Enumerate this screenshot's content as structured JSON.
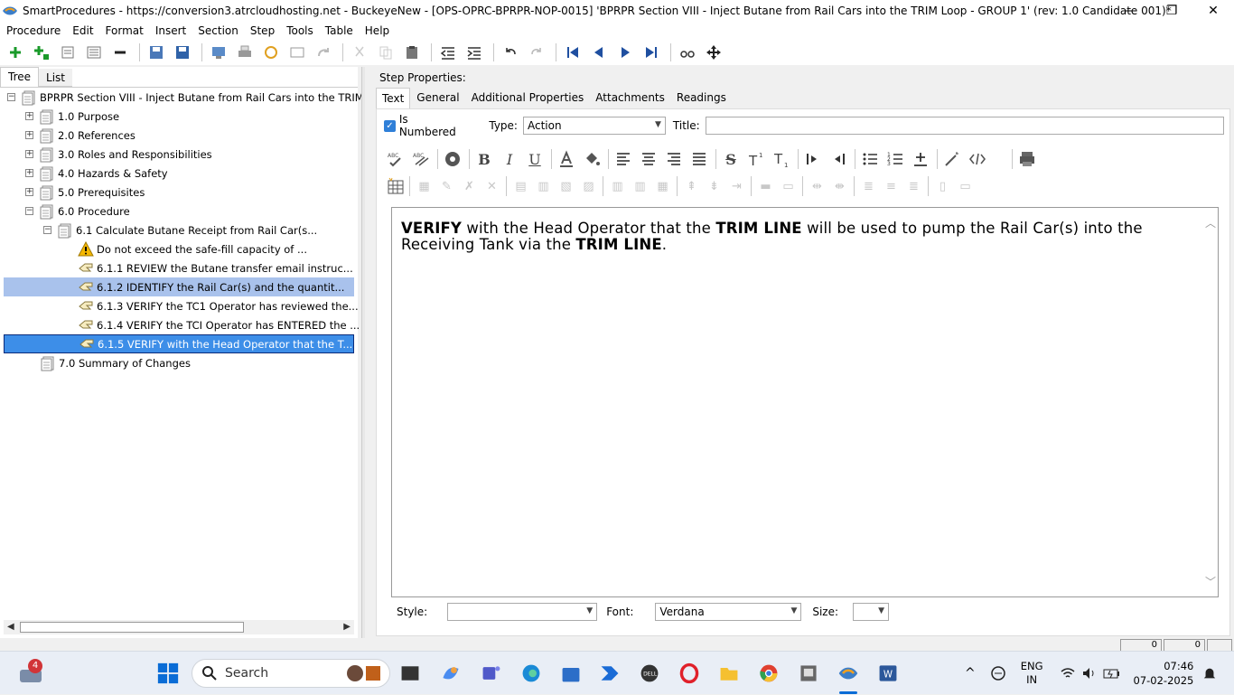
{
  "window": {
    "title": "SmartProcedures - https://conversion3.atrcloudhosting.net - BuckeyeNew - [OPS-OPRC-BPRPR-NOP-0015] 'BPRPR Section VIII - Inject Butane from Rail Cars into the TRIM Loop - GROUP 1' (rev: 1.0 Candidate 001)*",
    "minimize": "—",
    "maximize": "❐",
    "close": "✕"
  },
  "menu": [
    "Procedure",
    "Edit",
    "Format",
    "Insert",
    "Section",
    "Step",
    "Tools",
    "Table",
    "Help"
  ],
  "left": {
    "tabs": [
      "Tree",
      "List"
    ],
    "tree": [
      {
        "label": "BPRPR Section VIII - Inject Butane from Rail Cars into the TRIM L...",
        "expander": "−",
        "icon": "document-icon"
      },
      {
        "label": "1.0 Purpose",
        "expander": "+",
        "icon": "section-icon"
      },
      {
        "label": "2.0 References",
        "expander": "+",
        "icon": "section-icon"
      },
      {
        "label": "3.0 Roles and Responsibilities",
        "expander": "+",
        "icon": "section-icon"
      },
      {
        "label": "4.0 Hazards & Safety",
        "expander": "+",
        "icon": "section-icon"
      },
      {
        "label": "5.0 Prerequisites",
        "expander": "+",
        "icon": "section-icon"
      },
      {
        "label": "6.0 Procedure",
        "expander": "−",
        "icon": "section-icon"
      },
      {
        "label": "6.1 Calculate Butane Receipt from Rail Car(s...",
        "expander": "−",
        "icon": "section-icon"
      },
      {
        "label": "Do not exceed the safe-fill capacity of ...",
        "expander": "",
        "icon": "warning-icon"
      },
      {
        "label": "6.1.1 REVIEW the Butane transfer email instruc...",
        "expander": "",
        "icon": "step-icon"
      },
      {
        "label": "6.1.2 IDENTIFY the Rail Car(s) and the quantit...",
        "expander": "",
        "icon": "step-icon"
      },
      {
        "label": "6.1.3 VERIFY the TC1 Operator has reviewed the...",
        "expander": "",
        "icon": "step-icon"
      },
      {
        "label": "6.1.4 VERIFY the TCI Operator has ENTERED the ...",
        "expander": "",
        "icon": "step-icon"
      },
      {
        "label": "6.1.5 VERIFY with the Head Operator that the T...",
        "expander": "",
        "icon": "step-icon"
      },
      {
        "label": "7.0 Summary of Changes",
        "expander": "",
        "icon": "section-icon"
      }
    ]
  },
  "right": {
    "header": "Step Properties:",
    "tabs": [
      "Text",
      "General",
      "Additional Properties",
      "Attachments",
      "Readings"
    ],
    "is_numbered_label": "Is Numbered",
    "type_label": "Type:",
    "type_value": "Action",
    "title_label": "Title:",
    "title_value": "",
    "editor": {
      "seg1_bold": "VERIFY",
      "seg2": " with the Head Operator that the ",
      "seg3_bold": "TRIM LINE",
      "seg4": " will be used to pump the Rail Car(s) into the Receiving Tank via the ",
      "seg5_bold": "TRIM LINE",
      "seg6": "."
    },
    "style_label": "Style:",
    "style_value": "",
    "font_label": "Font:",
    "font_value": "Verdana",
    "size_label": "Size:",
    "size_value": ""
  },
  "status": {
    "cell1": "0",
    "cell2": "0"
  },
  "taskbar": {
    "search_placeholder": "Search",
    "notification_count": "4",
    "lang_line1": "ENG",
    "lang_line2": "IN",
    "time": "07:46",
    "date": "07-02-2025"
  }
}
